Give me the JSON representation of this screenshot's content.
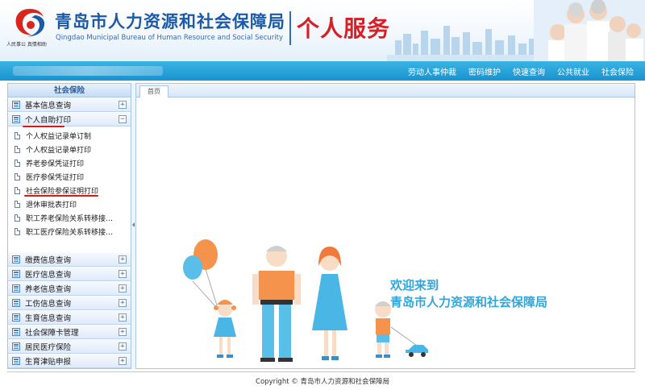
{
  "header": {
    "title_cn": "青岛市人力资源和社会保障局",
    "title_en": "Qingdao Municipal Bureau of Human Resource and Social Security",
    "service_title": "个人服务",
    "logo_caption": "人民事公  真情相助"
  },
  "nav": {
    "items": [
      "劳动人事仲裁",
      "密码维护",
      "快速查询",
      "公共就业",
      "社会保险"
    ]
  },
  "sidebar": {
    "title": "社会保险",
    "menus": [
      {
        "label": "基本信息查询",
        "toggle": "+"
      },
      {
        "label": "个人自助打印",
        "toggle": "−"
      },
      {
        "label": "缴费信息查询",
        "toggle": "+"
      },
      {
        "label": "医疗信息查询",
        "toggle": "+"
      },
      {
        "label": "养老信息查询",
        "toggle": "+"
      },
      {
        "label": "工伤信息查询",
        "toggle": "+"
      },
      {
        "label": "生育信息查询",
        "toggle": "+"
      },
      {
        "label": "社会保障卡管理",
        "toggle": "+"
      },
      {
        "label": "居民医疗保险",
        "toggle": "+"
      },
      {
        "label": "生育津贴申报",
        "toggle": "+"
      }
    ],
    "subitems": [
      "个人权益记录单订制",
      "个人权益记录单打印",
      "养老参保凭证打印",
      "医疗参保凭证打印",
      "社会保险参保证明打印",
      "退休审批表打印",
      "职工养老保险关系转移接…",
      "职工医疗保险关系转移接…"
    ]
  },
  "main": {
    "tab": "首页",
    "welcome_line1": "欢迎来到",
    "welcome_line2": "青岛市人力资源和社会保障局"
  },
  "footer": {
    "copyright": "Copyright © 青岛市人力资源和社会保障局"
  },
  "colors": {
    "nav_blue": "#1a93cf",
    "title_blue": "#1c5aa7",
    "service_red": "#d81f26",
    "welcome_blue": "#2fa6dd",
    "annotation_red": "#d11a1a"
  }
}
